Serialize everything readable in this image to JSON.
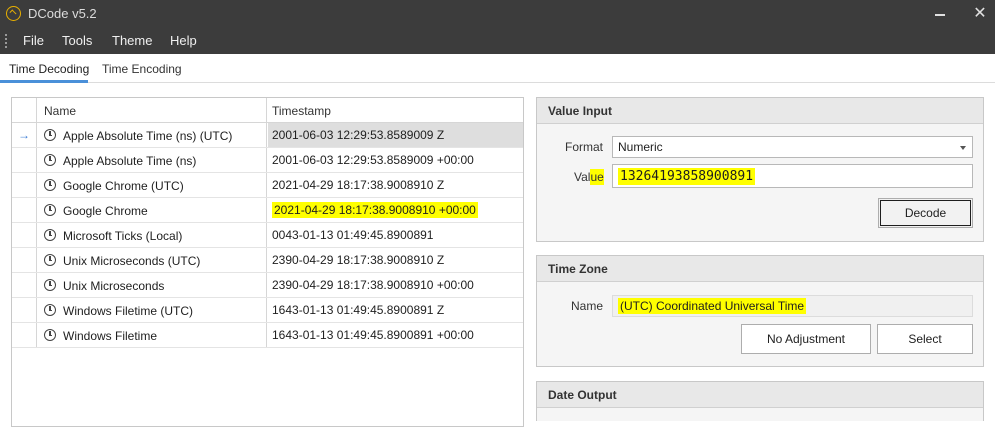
{
  "window": {
    "title": "DCode v5.2",
    "minimize_icon": "minimize-icon",
    "close_symbol": "✕"
  },
  "menu": [
    "File",
    "Tools",
    "Theme",
    "Help"
  ],
  "tabs": [
    {
      "label": "Time Decoding",
      "active": true
    },
    {
      "label": "Time Encoding",
      "active": false
    }
  ],
  "grid": {
    "columns": [
      "Name",
      "Timestamp"
    ],
    "current_row_marker": "→",
    "rows": [
      {
        "name": "Apple Absolute Time (ns) (UTC)",
        "timestamp": "2001-06-03 12:29:53.8589009 Z"
      },
      {
        "name": "Apple Absolute Time (ns)",
        "timestamp": "2001-06-03 12:29:53.8589009 +00:00"
      },
      {
        "name": "Google Chrome (UTC)",
        "timestamp": "2021-04-29 18:17:38.9008910 Z"
      },
      {
        "name": "Google Chrome",
        "timestamp": "2021-04-29 18:17:38.9008910 +00:00"
      },
      {
        "name": "Microsoft Ticks (Local)",
        "timestamp": "0043-01-13 01:49:45.8900891"
      },
      {
        "name": "Unix Microseconds (UTC)",
        "timestamp": "2390-04-29 18:17:38.9008910 Z"
      },
      {
        "name": "Unix Microseconds",
        "timestamp": "2390-04-29 18:17:38.9008910 +00:00"
      },
      {
        "name": "Windows Filetime (UTC)",
        "timestamp": "1643-01-13 01:49:45.8900891 Z"
      },
      {
        "name": "Windows Filetime",
        "timestamp": "1643-01-13 01:49:45.8900891 +00:00"
      }
    ]
  },
  "value_input": {
    "header": "Value Input",
    "format_label": "Format",
    "format_value": "Numeric",
    "value_label_a": "Val",
    "value_label_b": "ue",
    "value": "13264193858900891",
    "decode_label": "Decode"
  },
  "time_zone": {
    "header": "Time Zone",
    "name_label": "Name",
    "name_value": "(UTC) Coordinated Universal Time",
    "no_adjustment_label": "No Adjustment",
    "select_label": "Select"
  },
  "date_output": {
    "header": "Date Output"
  },
  "colors": {
    "highlight": "#ffff00",
    "accent": "#4a90d9",
    "titlebar": "#3c3c3c"
  }
}
